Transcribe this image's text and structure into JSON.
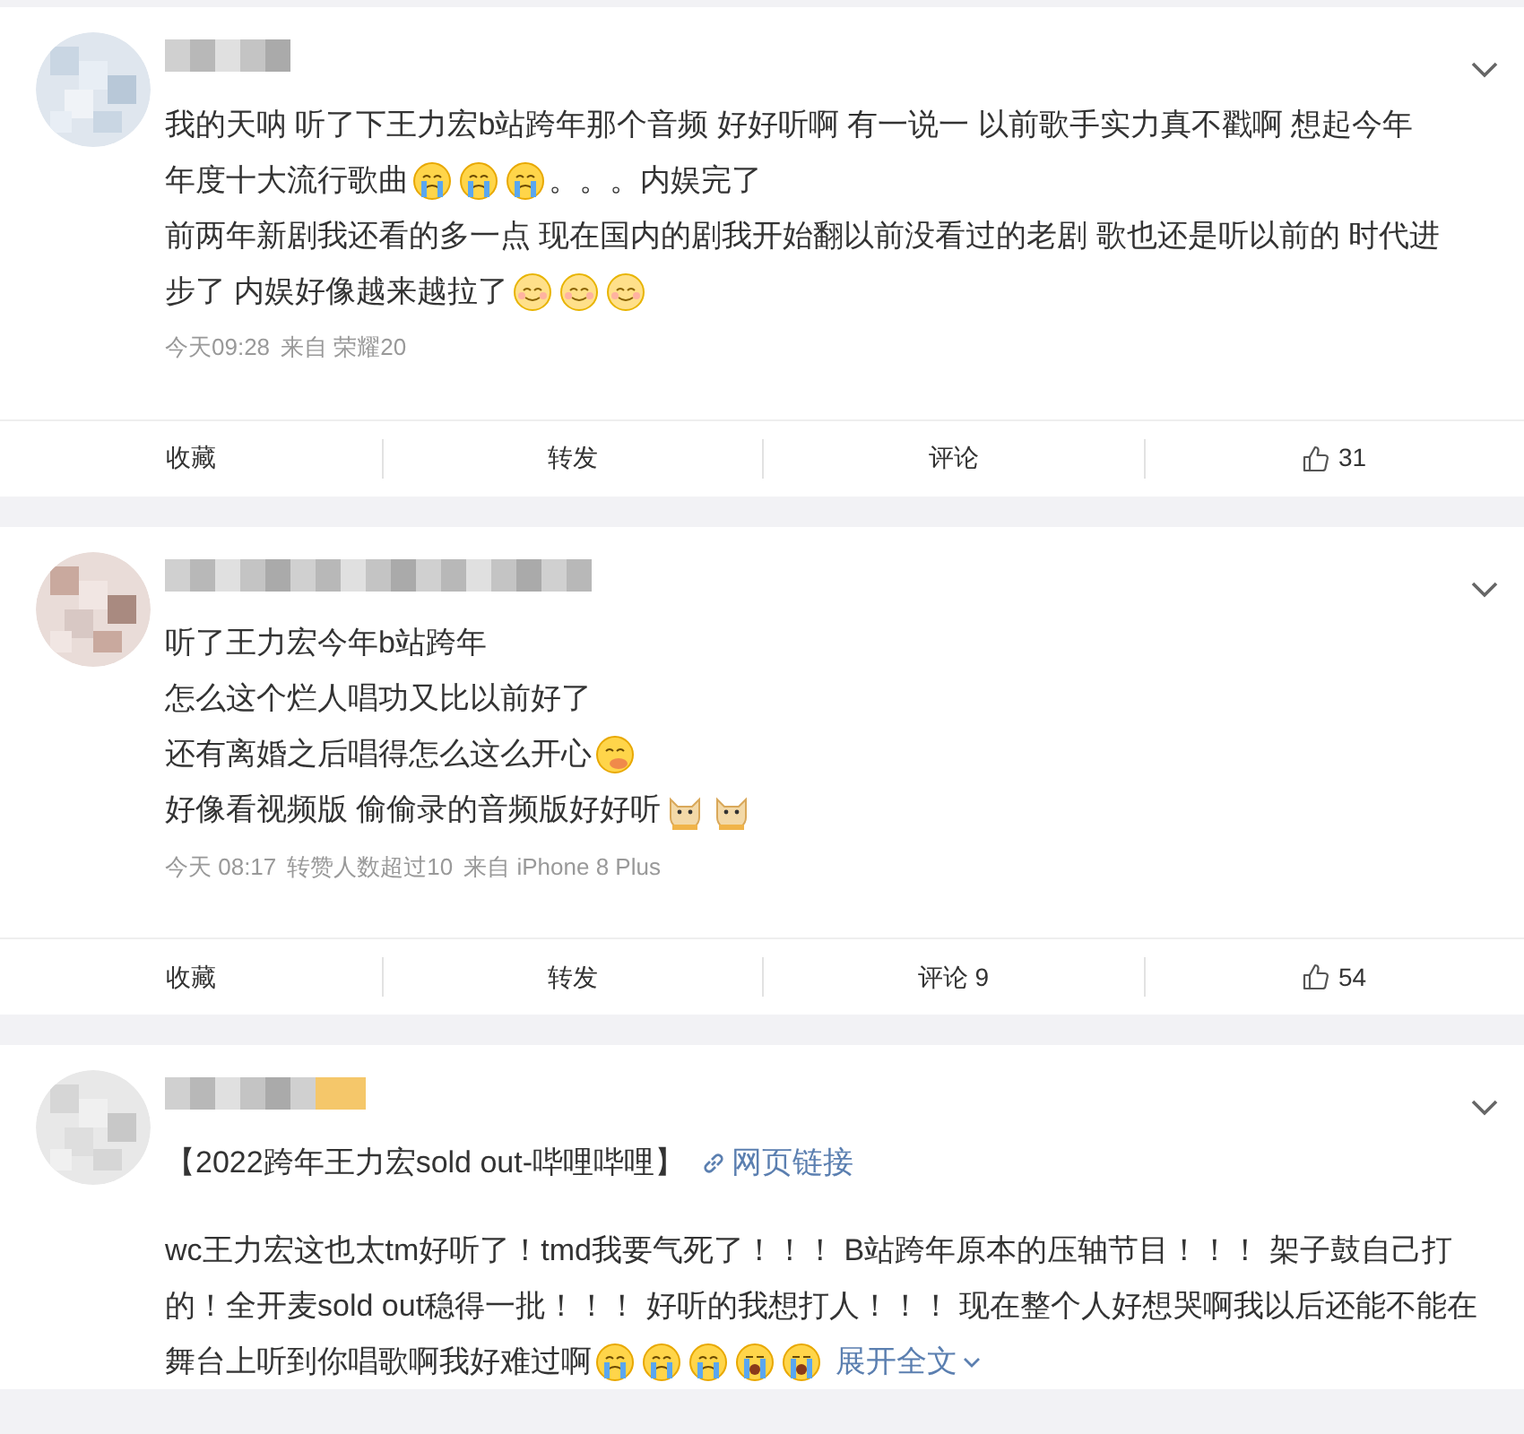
{
  "posts": [
    {
      "paragraphs": [
        [
          [
            {
              "kind": "text",
              "text": "我的天呐 听了下王力宏b站跨年那个音频 好好听啊 有一说一 以前歌手实力真不戳啊 想起今年"
            }
          ],
          [
            {
              "kind": "text",
              "text": "年度十大流行歌曲"
            },
            {
              "kind": "crying"
            },
            {
              "kind": "crying"
            },
            {
              "kind": "crying"
            },
            {
              "kind": "text",
              "text": "。。。内娱完了"
            }
          ],
          [
            {
              "kind": "text",
              "text": "前两年新剧我还看的多一点 现在国内的剧我开始翻以前没看过的老剧 歌也还是听以前的 时代进"
            }
          ],
          [
            {
              "kind": "text",
              "text": "步了 内娱好像越来越拉了"
            },
            {
              "kind": "smile"
            },
            {
              "kind": "smile"
            },
            {
              "kind": "smile"
            }
          ]
        ]
      ],
      "meta": [
        "今天09:28",
        "来自 荣耀20"
      ],
      "actions": [
        {
          "kind": "text",
          "label": "收藏"
        },
        {
          "kind": "text",
          "label": "转发"
        },
        {
          "kind": "text",
          "label": "评论"
        },
        {
          "kind": "like",
          "label": "31"
        }
      ]
    },
    {
      "paragraphs": [
        [
          [
            {
              "kind": "text",
              "text": "听了王力宏今年b站跨年"
            }
          ],
          [
            {
              "kind": "text",
              "text": "怎么这个烂人唱功又比以前好了"
            }
          ],
          [
            {
              "kind": "text",
              "text": "还有离婚之后唱得怎么这么开心"
            },
            {
              "kind": "yum"
            }
          ],
          [
            {
              "kind": "text",
              "text": "好像看视频版 偷偷录的音频版好好听"
            },
            {
              "kind": "dog"
            },
            {
              "kind": "dog"
            }
          ]
        ]
      ],
      "meta": [
        "今天 08:17",
        "转赞人数超过10",
        "来自 iPhone 8 Plus"
      ],
      "actions": [
        {
          "kind": "text",
          "label": "收藏"
        },
        {
          "kind": "text",
          "label": "转发"
        },
        {
          "kind": "text",
          "label": "评论 9"
        },
        {
          "kind": "like",
          "label": "54"
        }
      ]
    },
    {
      "paragraphs": [
        [
          [
            {
              "kind": "text",
              "text": "【2022跨年王力宏sold out-哔哩哔哩】"
            },
            {
              "kind": "link",
              "text": "网页链接"
            }
          ]
        ],
        [
          [
            {
              "kind": "text",
              "text": "wc王力宏这也太tm好听了！tmd我要气死了！！！ B站跨年原本的压轴节目！！！ 架子鼓自己打"
            }
          ],
          [
            {
              "kind": "text",
              "text": "的！全开麦sold out稳得一批！！！ 好听的我想打人！！！ 现在整个人好想哭啊我以后还能不能在"
            }
          ],
          [
            {
              "kind": "text",
              "text": "舞台上听到你唱歌啊我好难过啊"
            },
            {
              "kind": "crying"
            },
            {
              "kind": "crying"
            },
            {
              "kind": "crying"
            },
            {
              "kind": "sobbing"
            },
            {
              "kind": "sobbing"
            },
            {
              "kind": "expand",
              "text": "展开全文"
            }
          ]
        ]
      ]
    }
  ]
}
